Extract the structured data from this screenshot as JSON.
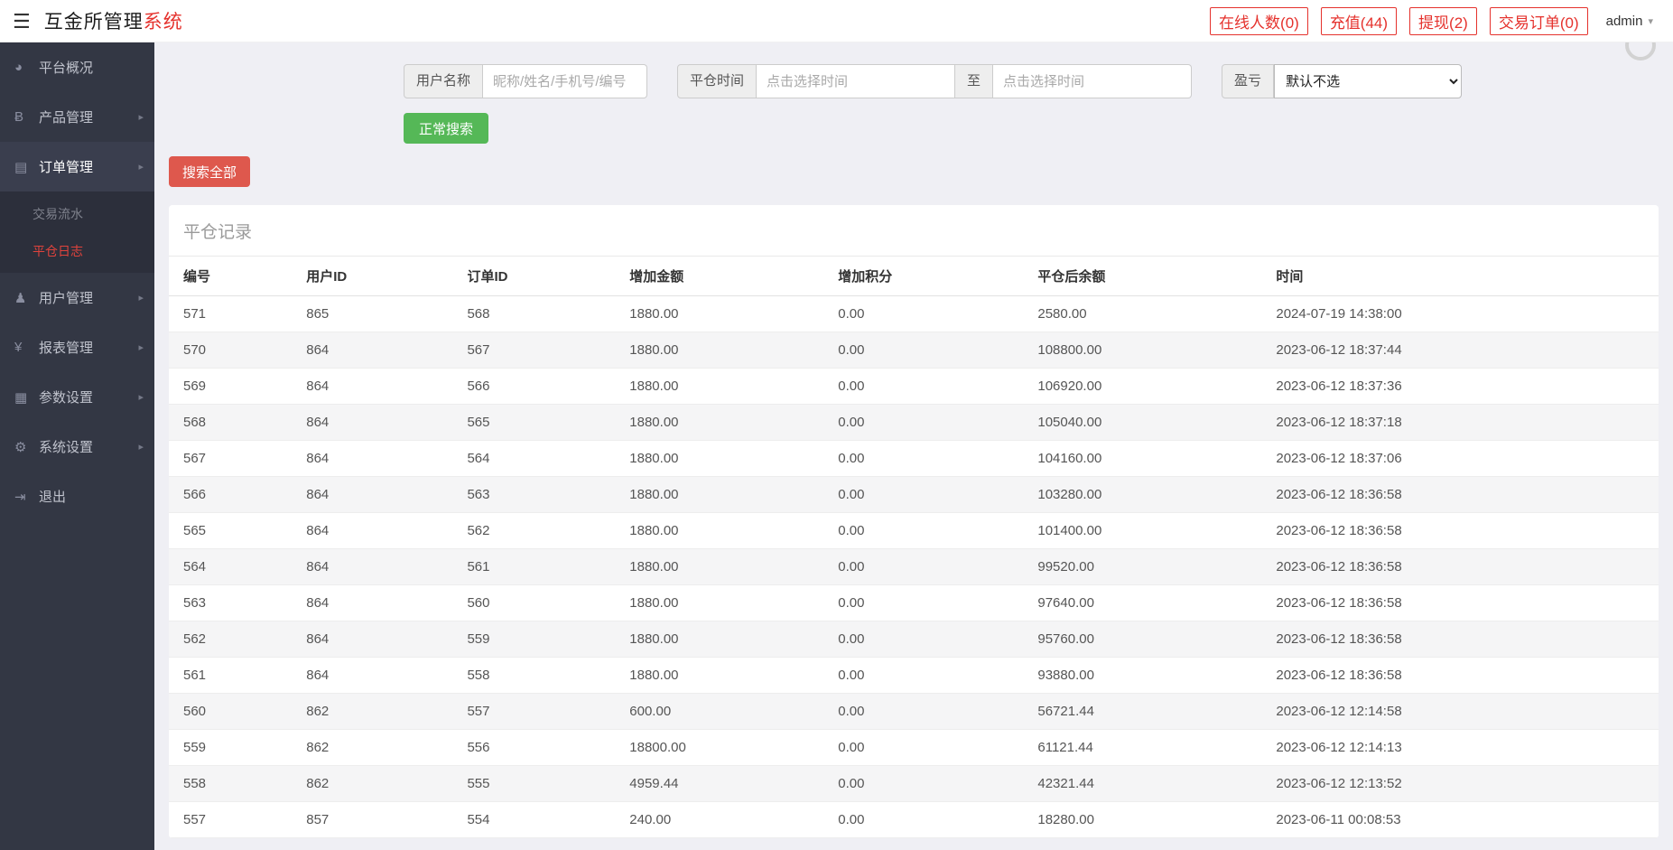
{
  "icons": {
    "menu": "☰",
    "dashboard": "◕",
    "product": "Ƀ",
    "order": "▤",
    "user": "♟",
    "report": "¥",
    "params": "▦",
    "settings": "⚙",
    "logout": "⇥",
    "chevron_right": "▸",
    "caret_down": "▾"
  },
  "colors": {
    "accent_red": "#e5322d",
    "sidebar_bg": "#333744",
    "submenu_active": "#e0433c",
    "button_green": "#55b857",
    "button_red": "#de584d",
    "content_bg": "#efeff4"
  },
  "header": {
    "brand_main": "互金所管理",
    "brand_accent": "系统",
    "links": [
      {
        "label": "在线人数(0)"
      },
      {
        "label": "充值(44)"
      },
      {
        "label": "提现(2)"
      },
      {
        "label": "交易订单(0)"
      }
    ],
    "user": "admin"
  },
  "sidebar": {
    "items": [
      {
        "label": "平台概况"
      },
      {
        "label": "产品管理"
      },
      {
        "label": "订单管理",
        "children": [
          {
            "label": "交易流水"
          },
          {
            "label": "平仓日志"
          }
        ]
      },
      {
        "label": "用户管理"
      },
      {
        "label": "报表管理"
      },
      {
        "label": "参数设置"
      },
      {
        "label": "系统设置"
      },
      {
        "label": "退出"
      }
    ]
  },
  "search": {
    "username_label": "用户名称",
    "username_placeholder": "昵称/姓名/手机号/编号",
    "time_label": "平仓时间",
    "time_from_placeholder": "点击选择时间",
    "to_label": "至",
    "time_to_placeholder": "点击选择时间",
    "profit_label": "盈亏",
    "profit_selected": "默认不选",
    "search_button": "正常搜索",
    "search_all_button": "搜索全部"
  },
  "panel": {
    "title": "平仓记录",
    "columns": [
      "编号",
      "用户ID",
      "订单ID",
      "增加金额",
      "增加积分",
      "平仓后余额",
      "时间"
    ],
    "rows": [
      [
        "571",
        "865",
        "568",
        "1880.00",
        "0.00",
        "2580.00",
        "2024-07-19 14:38:00"
      ],
      [
        "570",
        "864",
        "567",
        "1880.00",
        "0.00",
        "108800.00",
        "2023-06-12 18:37:44"
      ],
      [
        "569",
        "864",
        "566",
        "1880.00",
        "0.00",
        "106920.00",
        "2023-06-12 18:37:36"
      ],
      [
        "568",
        "864",
        "565",
        "1880.00",
        "0.00",
        "105040.00",
        "2023-06-12 18:37:18"
      ],
      [
        "567",
        "864",
        "564",
        "1880.00",
        "0.00",
        "104160.00",
        "2023-06-12 18:37:06"
      ],
      [
        "566",
        "864",
        "563",
        "1880.00",
        "0.00",
        "103280.00",
        "2023-06-12 18:36:58"
      ],
      [
        "565",
        "864",
        "562",
        "1880.00",
        "0.00",
        "101400.00",
        "2023-06-12 18:36:58"
      ],
      [
        "564",
        "864",
        "561",
        "1880.00",
        "0.00",
        "99520.00",
        "2023-06-12 18:36:58"
      ],
      [
        "563",
        "864",
        "560",
        "1880.00",
        "0.00",
        "97640.00",
        "2023-06-12 18:36:58"
      ],
      [
        "562",
        "864",
        "559",
        "1880.00",
        "0.00",
        "95760.00",
        "2023-06-12 18:36:58"
      ],
      [
        "561",
        "864",
        "558",
        "1880.00",
        "0.00",
        "93880.00",
        "2023-06-12 18:36:58"
      ],
      [
        "560",
        "862",
        "557",
        "600.00",
        "0.00",
        "56721.44",
        "2023-06-12 12:14:58"
      ],
      [
        "559",
        "862",
        "556",
        "18800.00",
        "0.00",
        "61121.44",
        "2023-06-12 12:14:13"
      ],
      [
        "558",
        "862",
        "555",
        "4959.44",
        "0.00",
        "42321.44",
        "2023-06-12 12:13:52"
      ],
      [
        "557",
        "857",
        "554",
        "240.00",
        "0.00",
        "18280.00",
        "2023-06-11 00:08:53"
      ]
    ]
  }
}
